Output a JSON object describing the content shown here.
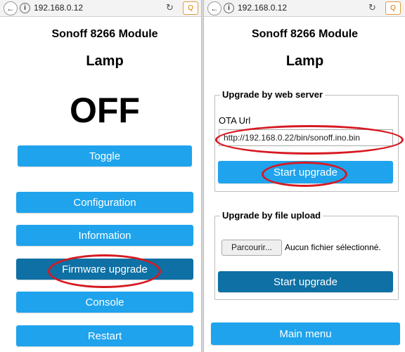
{
  "left": {
    "browser": {
      "address": "192.168.0.12",
      "reload_icon": "↻",
      "search_icon": "Q"
    },
    "module_title": "Sonoff 8266 Module",
    "device_name": "Lamp",
    "state": "OFF",
    "buttons": {
      "toggle": "Toggle",
      "configuration": "Configuration",
      "information": "Information",
      "firmware_upgrade": "Firmware upgrade",
      "console": "Console",
      "restart": "Restart"
    }
  },
  "right": {
    "browser": {
      "address": "192.168.0.12",
      "reload_icon": "↻",
      "search_icon": "Q"
    },
    "module_title": "Sonoff 8266 Module",
    "device_name": "Lamp",
    "web_server": {
      "legend": "Upgrade by web server",
      "ota_label": "OTA Url",
      "ota_value": "http://192.168.0.22/bin/sonoff.ino.bin",
      "start_button": "Start upgrade"
    },
    "file_upload": {
      "legend": "Upgrade by file upload",
      "browse_button": "Parcourir...",
      "no_file_text": "Aucun fichier sélectionné.",
      "start_button": "Start upgrade"
    },
    "main_menu_button": "Main menu"
  },
  "colors": {
    "button": "#1fa3ec",
    "button_active": "#0e70a4",
    "highlight_ellipse": "#d71921"
  }
}
